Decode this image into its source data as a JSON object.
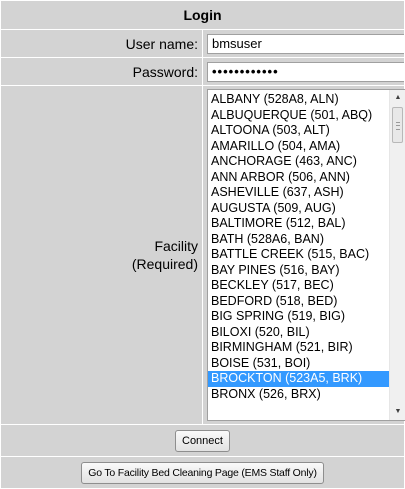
{
  "form": {
    "title": "Login",
    "username_label": "User name:",
    "username_value": "bmsuser",
    "password_label": "Password:",
    "password_value": "••••••••••••",
    "facility_label_line1": "Facility",
    "facility_label_line2": "(Required)",
    "connect_button": "Connect",
    "bed_cleaning_button": "Go To Facility Bed Cleaning Page (EMS Staff Only)"
  },
  "facilities": {
    "items": [
      "ALBANY (528A8, ALN)",
      "ALBUQUERQUE (501, ABQ)",
      "ALTOONA (503, ALT)",
      "AMARILLO (504, AMA)",
      "ANCHORAGE (463, ANC)",
      "ANN ARBOR (506, ANN)",
      "ASHEVILLE (637, ASH)",
      "AUGUSTA (509, AUG)",
      "BALTIMORE (512, BAL)",
      "BATH (528A6, BAN)",
      "BATTLE CREEK (515, BAC)",
      "BAY PINES (516, BAY)",
      "BECKLEY (517, BEC)",
      "BEDFORD (518, BED)",
      "BIG SPRING (519, BIG)",
      "BILOXI (520, BIL)",
      "BIRMINGHAM (521, BIR)",
      "BOISE (531, BOI)",
      "BROCKTON (523A5, BRK)",
      "BRONX (526, BRX)"
    ],
    "selected_index": 18,
    "scroll_up_icon": "triangle-up-icon",
    "scroll_down_icon": "triangle-down-icon"
  },
  "colors": {
    "row_background": "#d3d3d3",
    "selection": "#3399ff"
  }
}
